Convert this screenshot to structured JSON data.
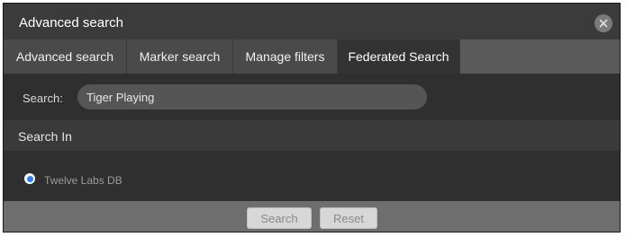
{
  "dialog": {
    "title": "Advanced search",
    "close_icon": "close-icon"
  },
  "tabs": [
    {
      "label": "Advanced search",
      "active": false
    },
    {
      "label": "Marker search",
      "active": false
    },
    {
      "label": "Manage filters",
      "active": false
    },
    {
      "label": "Federated Search",
      "active": true
    }
  ],
  "search": {
    "label": "Search:",
    "value": "Tiger Playing"
  },
  "search_in": {
    "title": "Search In",
    "options": [
      {
        "label": "Twelve Labs DB",
        "selected": true
      }
    ]
  },
  "footer": {
    "search_label": "Search",
    "reset_label": "Reset"
  },
  "colors": {
    "radio_accent": "#2f7df6",
    "active_tab": "#333333"
  }
}
